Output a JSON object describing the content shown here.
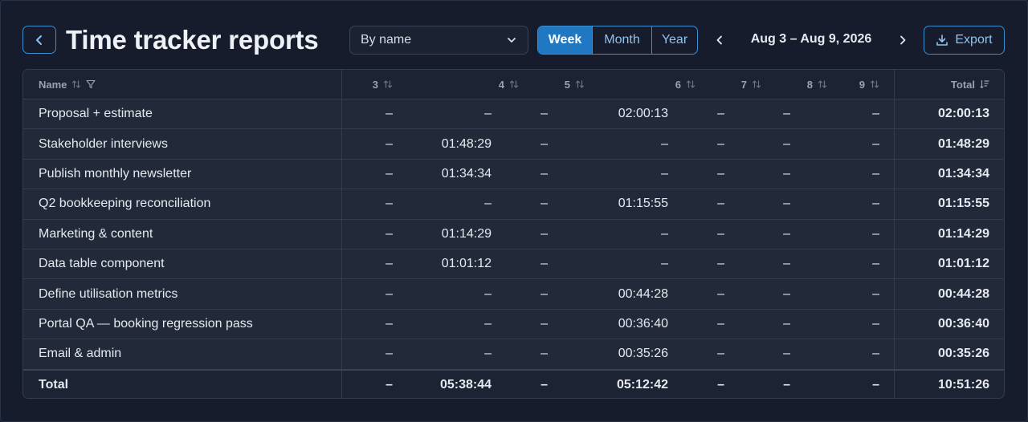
{
  "header": {
    "title": "Time tracker reports",
    "group_by": "By name",
    "periods": [
      "Week",
      "Month",
      "Year"
    ],
    "active_period": "Week",
    "date_range": "Aug 3 – Aug 9, 2026",
    "export_label": "Export"
  },
  "table": {
    "columns": [
      "Name",
      "3",
      "4",
      "5",
      "6",
      "7",
      "8",
      "9",
      "Total"
    ],
    "rows": [
      {
        "name": "Proposal + estimate",
        "days": [
          "–",
          "–",
          "–",
          "02:00:13",
          "–",
          "–",
          "–"
        ],
        "total": "02:00:13"
      },
      {
        "name": "Stakeholder interviews",
        "days": [
          "–",
          "01:48:29",
          "–",
          "–",
          "–",
          "–",
          "–"
        ],
        "total": "01:48:29"
      },
      {
        "name": "Publish monthly newsletter",
        "days": [
          "–",
          "01:34:34",
          "–",
          "–",
          "–",
          "–",
          "–"
        ],
        "total": "01:34:34"
      },
      {
        "name": "Q2 bookkeeping reconciliation",
        "days": [
          "–",
          "–",
          "–",
          "01:15:55",
          "–",
          "–",
          "–"
        ],
        "total": "01:15:55"
      },
      {
        "name": "Marketing & content",
        "days": [
          "–",
          "01:14:29",
          "–",
          "–",
          "–",
          "–",
          "–"
        ],
        "total": "01:14:29"
      },
      {
        "name": "Data table component",
        "days": [
          "–",
          "01:01:12",
          "–",
          "–",
          "–",
          "–",
          "–"
        ],
        "total": "01:01:12"
      },
      {
        "name": "Define utilisation metrics",
        "days": [
          "–",
          "–",
          "–",
          "00:44:28",
          "–",
          "–",
          "–"
        ],
        "total": "00:44:28"
      },
      {
        "name": "Portal QA — booking regression pass",
        "days": [
          "–",
          "–",
          "–",
          "00:36:40",
          "–",
          "–",
          "–"
        ],
        "total": "00:36:40"
      },
      {
        "name": "Email & admin",
        "days": [
          "–",
          "–",
          "–",
          "00:35:26",
          "–",
          "–",
          "–"
        ],
        "total": "00:35:26"
      }
    ],
    "footer": {
      "name": "Total",
      "days": [
        "–",
        "05:38:44",
        "–",
        "05:12:42",
        "–",
        "–",
        "–"
      ],
      "total": "10:51:26"
    }
  }
}
